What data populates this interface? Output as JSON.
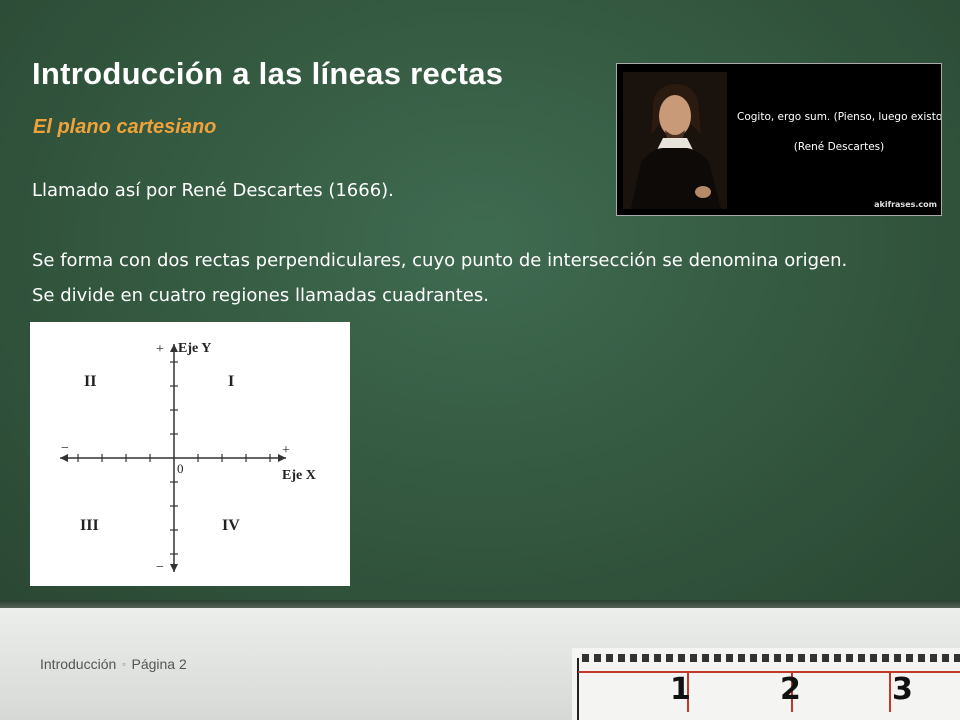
{
  "slide": {
    "title": "Introducción a las líneas rectas",
    "subtitle": "El plano cartesiano",
    "body": [
      "Llamado así por René Descartes (1666).",
      "Se forma con dos rectas perpendiculares, cuyo punto de intersección se denomina origen.",
      "Se divide en cuatro regiones llamadas cuadrantes."
    ]
  },
  "quote_image": {
    "quote": "Cogito, ergo sum. (Pienso, luego existo).",
    "author": "(René Descartes)",
    "watermark": "akifrases.com"
  },
  "cartesian_plane": {
    "y_axis_label": "Eje Y",
    "x_axis_label": "Eje X",
    "origin_label": "0",
    "plus_sign": "+",
    "minus_sign": "−",
    "quadrants": [
      "I",
      "II",
      "III",
      "IV"
    ]
  },
  "footer": {
    "section": "Introducción",
    "page": "Página 2"
  },
  "ruler_numbers": [
    "1",
    "2",
    "3"
  ],
  "colors": {
    "board": "#3f6b51",
    "subtitle": "#f0a23a",
    "text": "#ffffff",
    "ruler_mark": "#c0392b"
  }
}
